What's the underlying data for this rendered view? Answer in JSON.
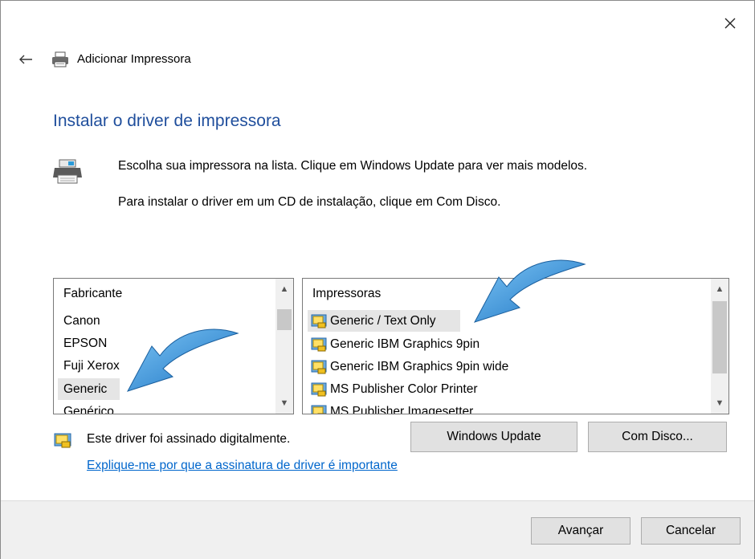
{
  "window": {
    "title": "Adicionar Impressora",
    "close_icon": "close-icon",
    "back_icon": "back-arrow-icon"
  },
  "page": {
    "heading": "Instalar o driver de impressora",
    "instruction_1": "Escolha sua impressora na lista. Clique em Windows Update para ver mais modelos.",
    "instruction_2": "Para instalar o driver em um CD de instalação, clique em Com Disco."
  },
  "manufacturers": {
    "header": "Fabricante",
    "items": [
      "Canon",
      "EPSON",
      "Fuji Xerox",
      "Generic",
      "Genérico"
    ],
    "selected": "Generic"
  },
  "printers": {
    "header": "Impressoras",
    "items": [
      "Generic / Text Only",
      "Generic IBM Graphics 9pin",
      "Generic IBM Graphics 9pin wide",
      "MS Publisher Color Printer",
      "MS Publisher Imagesetter"
    ],
    "selected": "Generic / Text Only"
  },
  "signature": {
    "text": "Este driver foi assinado digitalmente.",
    "link": "Explique-me por que a assinatura de driver é importante"
  },
  "buttons": {
    "windows_update": "Windows Update",
    "have_disk": "Com Disco...",
    "next": "Avançar",
    "cancel": "Cancelar"
  },
  "colors": {
    "heading": "#1f4e9c",
    "link": "#0066cc",
    "annotation_arrow": "#2f8fd6"
  }
}
